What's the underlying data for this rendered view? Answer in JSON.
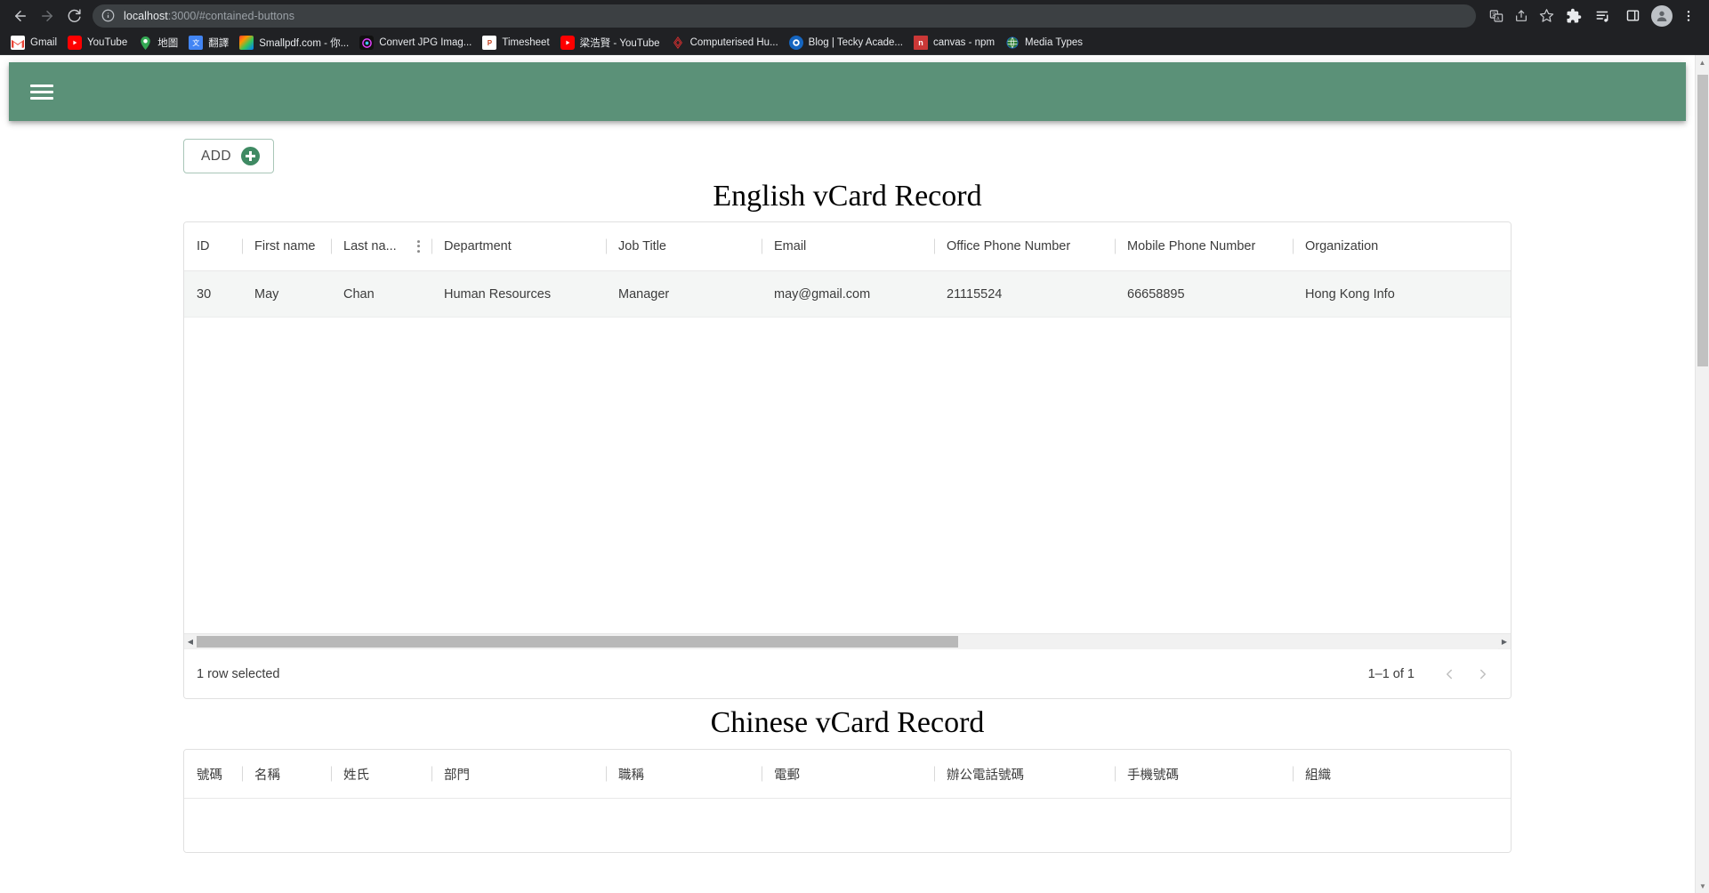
{
  "browser": {
    "nav": {
      "back": "back-arrow",
      "forward": "forward-arrow",
      "reload": "reload"
    },
    "omnibox": {
      "info_icon": "info-circle-icon",
      "url_host": "localhost",
      "url_rest": ":3000/#contained-buttons",
      "full_url": "localhost:3000/#contained-buttons",
      "right_icons": [
        "translate-icon",
        "share-icon",
        "bookmark-star-icon"
      ]
    },
    "toolbar_icons": [
      "extensions-puzzle-icon",
      "reading-list-icon",
      "side-panel-icon",
      "profile-avatar-icon",
      "chrome-menu-icon"
    ],
    "bookmarks": [
      {
        "label": "Gmail",
        "icon": "gmail-icon"
      },
      {
        "label": "YouTube",
        "icon": "youtube-icon"
      },
      {
        "label": "地圖",
        "icon": "google-maps-icon"
      },
      {
        "label": "翻譯",
        "icon": "google-translate-icon"
      },
      {
        "label": "Smallpdf.com - 你...",
        "icon": "smallpdf-icon"
      },
      {
        "label": "Convert JPG Imag...",
        "icon": "convert-jpg-icon"
      },
      {
        "label": "Timesheet",
        "icon": "powerpoint-icon"
      },
      {
        "label": "梁浩賢 - YouTube",
        "icon": "youtube-icon"
      },
      {
        "label": "Computerised Hu...",
        "icon": "computerised-icon"
      },
      {
        "label": "Blog | Tecky Acade...",
        "icon": "tecky-icon"
      },
      {
        "label": "canvas - npm",
        "icon": "npm-icon"
      },
      {
        "label": "Media Types",
        "icon": "globe-icon"
      }
    ]
  },
  "app": {
    "appbar": {
      "menu_icon": "hamburger-menu-icon",
      "color": "#5b9178"
    },
    "add_button": {
      "label": "ADD",
      "icon": "plus-circle-icon",
      "accent": "#3f8a63"
    },
    "english_section": {
      "title": "English vCard Record",
      "columns": [
        {
          "key": "id",
          "label": "ID",
          "width_class": "c-id",
          "menu": false
        },
        {
          "key": "first_name",
          "label": "First name",
          "width_class": "c-first",
          "menu": false
        },
        {
          "key": "last_name",
          "label": "Last na...",
          "width_class": "c-last",
          "menu": true
        },
        {
          "key": "department",
          "label": "Department",
          "width_class": "c-dept",
          "menu": false
        },
        {
          "key": "job_title",
          "label": "Job Title",
          "width_class": "c-job",
          "menu": false
        },
        {
          "key": "email",
          "label": "Email",
          "width_class": "c-email",
          "menu": false
        },
        {
          "key": "office_phone",
          "label": "Office Phone Number",
          "width_class": "c-off",
          "menu": false
        },
        {
          "key": "mobile_phone",
          "label": "Mobile Phone Number",
          "width_class": "c-mob",
          "menu": false
        },
        {
          "key": "organization",
          "label": "Organization",
          "width_class": "c-org",
          "menu": false
        }
      ],
      "rows": [
        {
          "id": "30",
          "first_name": "May",
          "last_name": "Chan",
          "department": "Human Resources",
          "job_title": "Manager",
          "email": "may@gmail.com",
          "office_phone": "21115524",
          "mobile_phone": "66658895",
          "organization": "Hong Kong Info"
        }
      ],
      "footer": {
        "selection_text": "1 row selected",
        "page_range": "1–1 of 1",
        "prev_icon": "chevron-left-icon",
        "next_icon": "chevron-right-icon"
      }
    },
    "chinese_section": {
      "title": "Chinese vCard Record",
      "columns": [
        {
          "key": "id",
          "label": "號碼",
          "width_class": "c-id"
        },
        {
          "key": "first_name",
          "label": "名稱",
          "width_class": "c-first"
        },
        {
          "key": "last_name",
          "label": "姓氏",
          "width_class": "c-last"
        },
        {
          "key": "department",
          "label": "部門",
          "width_class": "c-dept"
        },
        {
          "key": "job_title",
          "label": "職稱",
          "width_class": "c-job"
        },
        {
          "key": "email",
          "label": "電郵",
          "width_class": "c-email"
        },
        {
          "key": "office_phone",
          "label": "辦公電話號碼",
          "width_class": "c-off"
        },
        {
          "key": "mobile_phone",
          "label": "手機號碼",
          "width_class": "c-mob"
        },
        {
          "key": "organization",
          "label": "組織",
          "width_class": "c-org"
        }
      ],
      "rows": []
    }
  }
}
